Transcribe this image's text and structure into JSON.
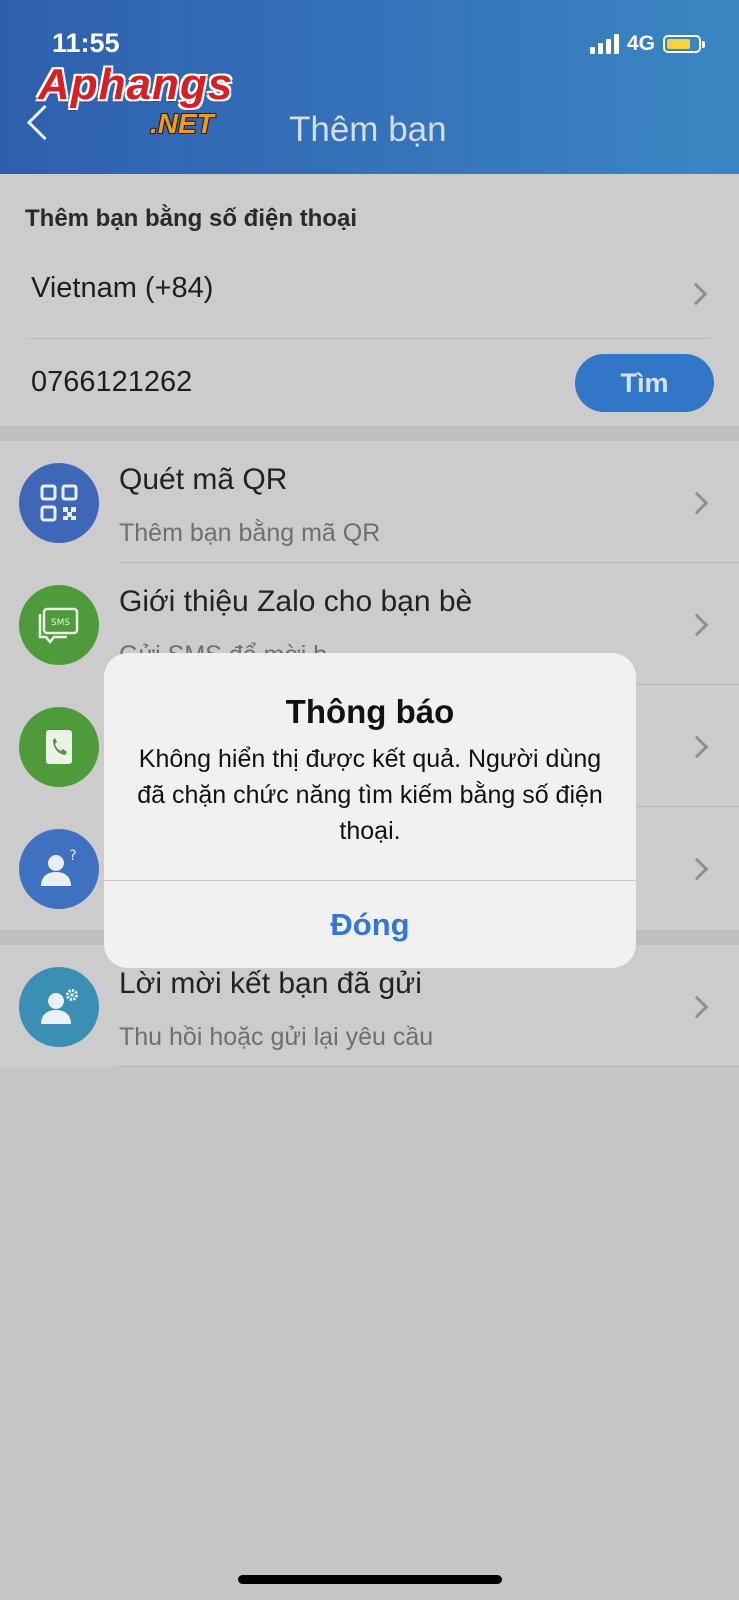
{
  "status_bar": {
    "time": "11:55",
    "network": "4G"
  },
  "header": {
    "logo_main": "Aphangs",
    "logo_sub": ".NET",
    "title": "Thêm bạn"
  },
  "phone_search": {
    "heading": "Thêm bạn bằng số điện thoại",
    "country": "Vietnam (+84)",
    "phone_number": "0766121262",
    "find_label": "Tìm"
  },
  "list": {
    "items": [
      {
        "title": "Quét mã QR",
        "subtitle": "Thêm bạn bằng mã QR",
        "icon": "qr-code-icon",
        "color": "#3e67b8"
      },
      {
        "title": "Giới thiệu Zalo cho bạn bè",
        "subtitle": "Gửi SMS để mời b",
        "icon": "sms-icon",
        "color": "#4f9a3a"
      },
      {
        "title": "",
        "subtitle": "",
        "icon": "phone-contacts-icon",
        "color": "#4f9a3a"
      },
      {
        "title": "",
        "subtitle": "",
        "icon": "person-question-icon",
        "color": "#3e72c0"
      }
    ],
    "sent_requests": {
      "title": "Lời mời kết bạn đã gửi",
      "subtitle": "Thu hồi hoặc gửi lại yêu cầu",
      "icon": "person-gear-icon",
      "color": "#3b8fb3"
    }
  },
  "dialog": {
    "title": "Thông báo",
    "message": "Không hiển thị được kết quả. Người dùng đã chặn chức năng tìm kiếm bằng số điện thoại.",
    "close_label": "Đóng"
  },
  "colors": {
    "header_start": "#2e5fae",
    "header_end": "#3a86c2",
    "accent": "#3277c7",
    "dialog_button": "#3574d8"
  }
}
